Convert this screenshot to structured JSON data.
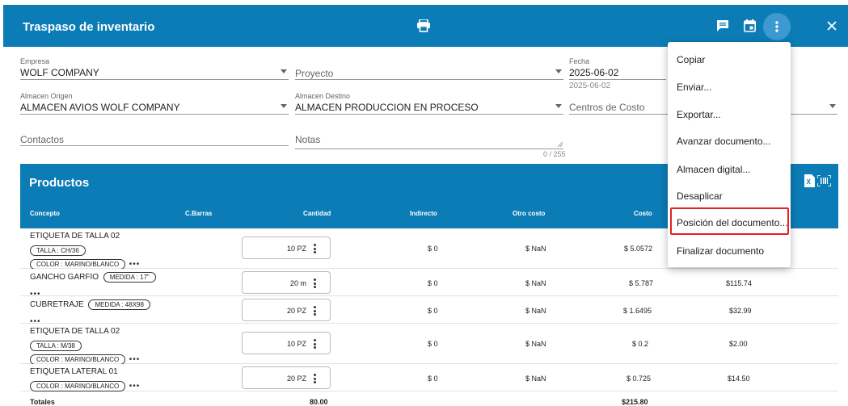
{
  "header": {
    "title": "Traspaso de inventario",
    "print_icon": "printer-icon",
    "comment_icon": "comment-icon",
    "calendar_icon": "calendar-icon",
    "more_icon": "more-vert-icon",
    "close_icon": "close-icon",
    "color": "#0c7cb6"
  },
  "form": {
    "empresa": {
      "label": "Empresa",
      "value": "WOLF COMPANY"
    },
    "proyecto": {
      "placeholder": "Proyecto"
    },
    "fecha": {
      "label": "Fecha",
      "value": "2025-06-02",
      "hint": "2025-06-02"
    },
    "almacen_origen": {
      "label": "Almacen Origen",
      "value": "ALMACEN AVIOS WOLF COMPANY"
    },
    "almacen_destino": {
      "label": "Almacen Destino",
      "value": "ALMACEN PRODUCCION EN PROCESO"
    },
    "centros_costo": {
      "placeholder": "Centros de Costo"
    },
    "contactos": {
      "placeholder": "Contactos"
    },
    "notas": {
      "placeholder": "Notas",
      "counter": "0 / 255"
    }
  },
  "products": {
    "title": "Productos",
    "excel_icon": "excel-icon",
    "barcode_icon": "barcode-scan-icon",
    "columns": {
      "concepto": "Concepto",
      "barras": "C.Barras",
      "cantidad": "Cantidad",
      "indirecto": "Indirecto",
      "otro_costo": "Otro costo",
      "costo": "Costo"
    },
    "rows": [
      {
        "concept": "ETIQUETA DE TALLA 02",
        "chips": [
          "TALLA : CH/36",
          "COLOR : MARINO/BLANCO"
        ],
        "qty": "10 PZ",
        "indirecto": "$ 0",
        "otro": "$ NaN",
        "costo": "$ 5.0572",
        "total": ""
      },
      {
        "concept": "GANCHO GARFIO",
        "chips": [
          "MEDIDA : 17\""
        ],
        "qty": "20 m",
        "indirecto": "$ 0",
        "otro": "$ NaN",
        "costo": "$ 5.787",
        "total": "$115.74"
      },
      {
        "concept": "CUBRETRAJE",
        "chips": [
          "MEDIDA : 48X98"
        ],
        "qty": "20 PZ",
        "indirecto": "$ 0",
        "otro": "$ NaN",
        "costo": "$ 1.6495",
        "total": "$32.99"
      },
      {
        "concept": "ETIQUETA DE TALLA 02",
        "chips": [
          "TALLA : M/38",
          "COLOR : MARINO/BLANCO"
        ],
        "qty": "10 PZ",
        "indirecto": "$ 0",
        "otro": "$ NaN",
        "costo": "$ 0.2",
        "total": "$2.00"
      },
      {
        "concept": "ETIQUETA LATERAL 01",
        "chips": [
          "COLOR : MARINO/BLANCO"
        ],
        "qty": "20 PZ",
        "indirecto": "$ 0",
        "otro": "$ NaN",
        "costo": "$ 0.725",
        "total": "$14.50"
      }
    ],
    "totals": {
      "label": "Totales",
      "qty": "80.00",
      "costo": "$215.80"
    }
  },
  "menu": {
    "items": [
      "Copiar",
      "Enviar...",
      "Exportar...",
      "Avanzar documento...",
      "Almacen digital...",
      "Desaplicar",
      "Posición del documento...",
      "Finalizar documento"
    ],
    "highlight_color": "#e32222"
  }
}
